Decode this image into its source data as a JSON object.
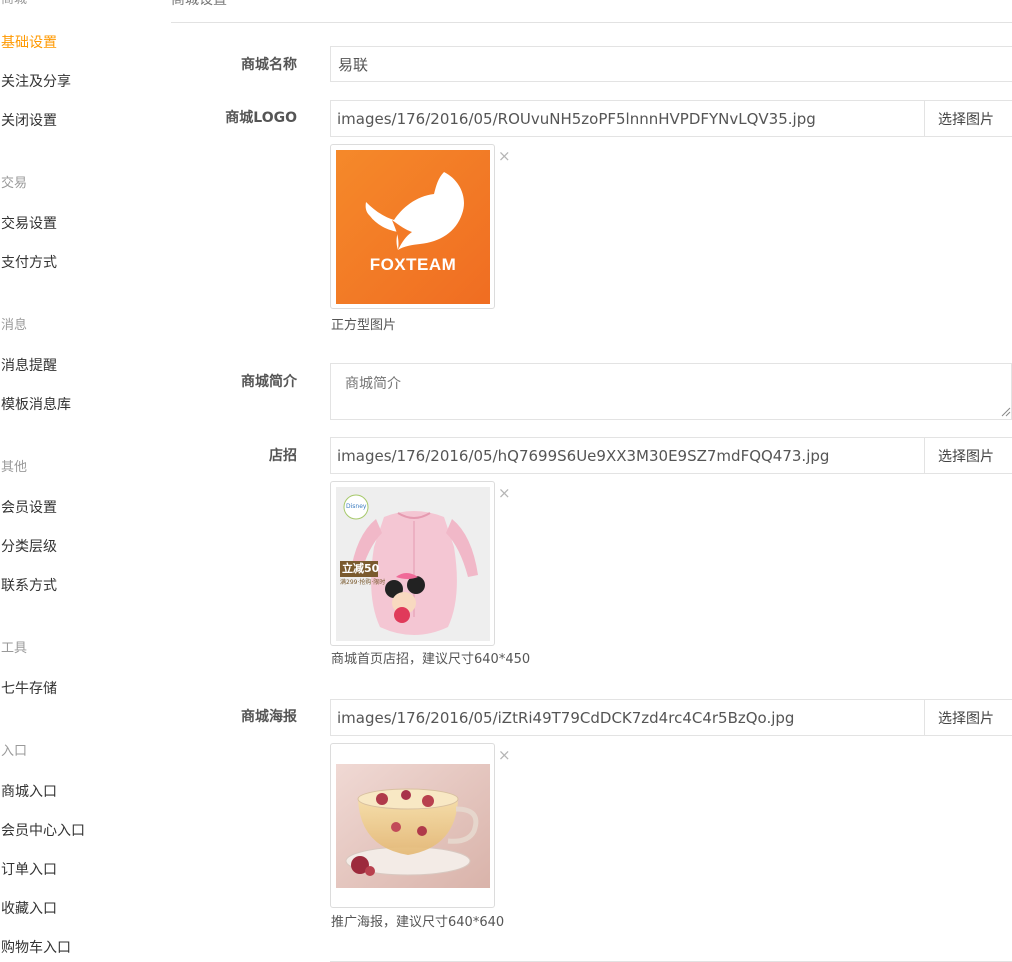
{
  "sidebar": {
    "groups": [
      {
        "title": "商城",
        "items": [
          "基础设置",
          "关注及分享",
          "关闭设置"
        ]
      },
      {
        "title": "交易",
        "items": [
          "交易设置",
          "支付方式"
        ]
      },
      {
        "title": "消息",
        "items": [
          "消息提醒",
          "模板消息库"
        ]
      },
      {
        "title": "其他",
        "items": [
          "会员设置",
          "分类层级",
          "联系方式"
        ]
      },
      {
        "title": "工具",
        "items": [
          "七牛存储"
        ]
      },
      {
        "title": "入口",
        "items": [
          "商城入口",
          "会员中心入口",
          "订单入口",
          "收藏入口",
          "购物车入口"
        ]
      }
    ],
    "active_item": "基础设置"
  },
  "header": {
    "title": "商城设置"
  },
  "form": {
    "shop_name": {
      "label": "商城名称",
      "value": "易联"
    },
    "shop_logo": {
      "label": "商城LOGO",
      "value": "images/176/2016/05/ROUvuNH5zoPF5lnnnHVPDFYNvLQV35.jpg",
      "button": "选择图片",
      "logo_text": "FOXTEAM",
      "help": "正方型图片"
    },
    "shop_intro": {
      "label": "商城简介",
      "placeholder": "商城简介"
    },
    "shop_banner": {
      "label": "店招",
      "value": "images/176/2016/05/hQ7699S6Ue9XX3M30E9SZ7mdFQQ473.jpg",
      "button": "选择图片",
      "image_text": {
        "badge": "立减50",
        "small": "满299·抢购·限时",
        "brand": "Disney"
      },
      "help": "商城首页店招，建议尺寸640*450"
    },
    "shop_poster": {
      "label": "商城海报",
      "value": "images/176/2016/05/iZtRi49T79CdDCK7zd4rc4C4r5BzQo.jpg",
      "button": "选择图片",
      "help": "推广海报，建议尺寸640*640"
    }
  },
  "icons": {
    "remove": "×"
  },
  "colors": {
    "accent": "#ff9900",
    "logo_orange": "#f26f22"
  }
}
